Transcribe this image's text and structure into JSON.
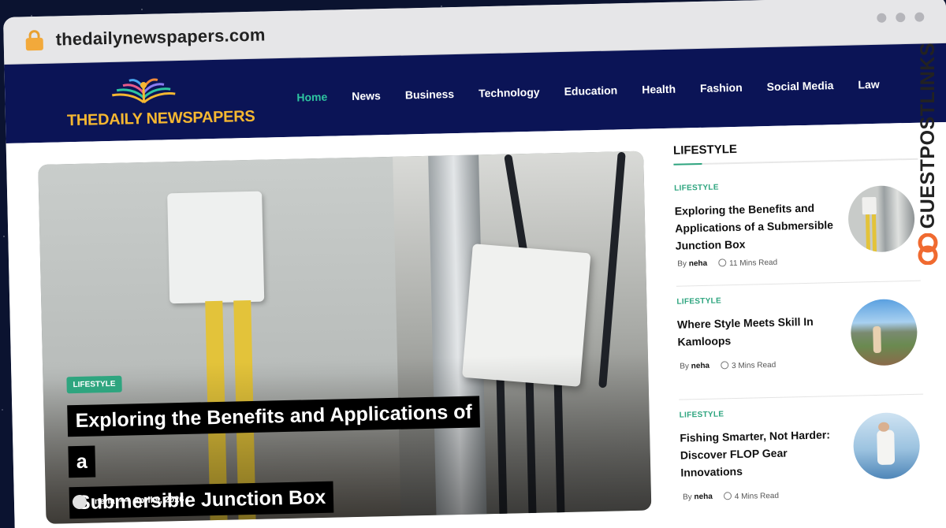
{
  "browser": {
    "url": "thedailynewspapers.com"
  },
  "site": {
    "logo_text": "THEDAILY NEWSPAPERS",
    "nav": [
      {
        "label": "Home",
        "active": true
      },
      {
        "label": "News"
      },
      {
        "label": "Business"
      },
      {
        "label": "Technology"
      },
      {
        "label": "Education"
      },
      {
        "label": "Health"
      },
      {
        "label": "Fashion"
      },
      {
        "label": "Social Media"
      },
      {
        "label": "Law"
      }
    ],
    "colors": {
      "header_bg": "#0b1456",
      "accent": "#2ea57f",
      "logo": "#f5b731"
    }
  },
  "hero": {
    "category": "LIFESTYLE",
    "title_line1": "Exploring the Benefits and Applications of a",
    "title_line2": "Submersible Junction Box",
    "author": "neha",
    "separator": "—",
    "date": "April 9, 2026"
  },
  "sidebar": {
    "heading": "LIFESTYLE",
    "posts": [
      {
        "category": "LIFESTYLE",
        "title": "Exploring the Benefits and Applications of a Submersible Junction Box",
        "by": "By",
        "author": "neha",
        "read_time": "11 Mins Read"
      },
      {
        "category": "LIFESTYLE",
        "title": "Where Style Meets Skill In Kamloops",
        "by": "By",
        "author": "neha",
        "read_time": "3 Mins Read"
      },
      {
        "category": "LIFESTYLE",
        "title": "Fishing Smarter, Not Harder: Discover FLOP Gear Innovations",
        "by": "By",
        "author": "neha",
        "read_time": "4 Mins Read"
      }
    ]
  },
  "watermark": {
    "text": "GUESTPOSTLINKS"
  }
}
